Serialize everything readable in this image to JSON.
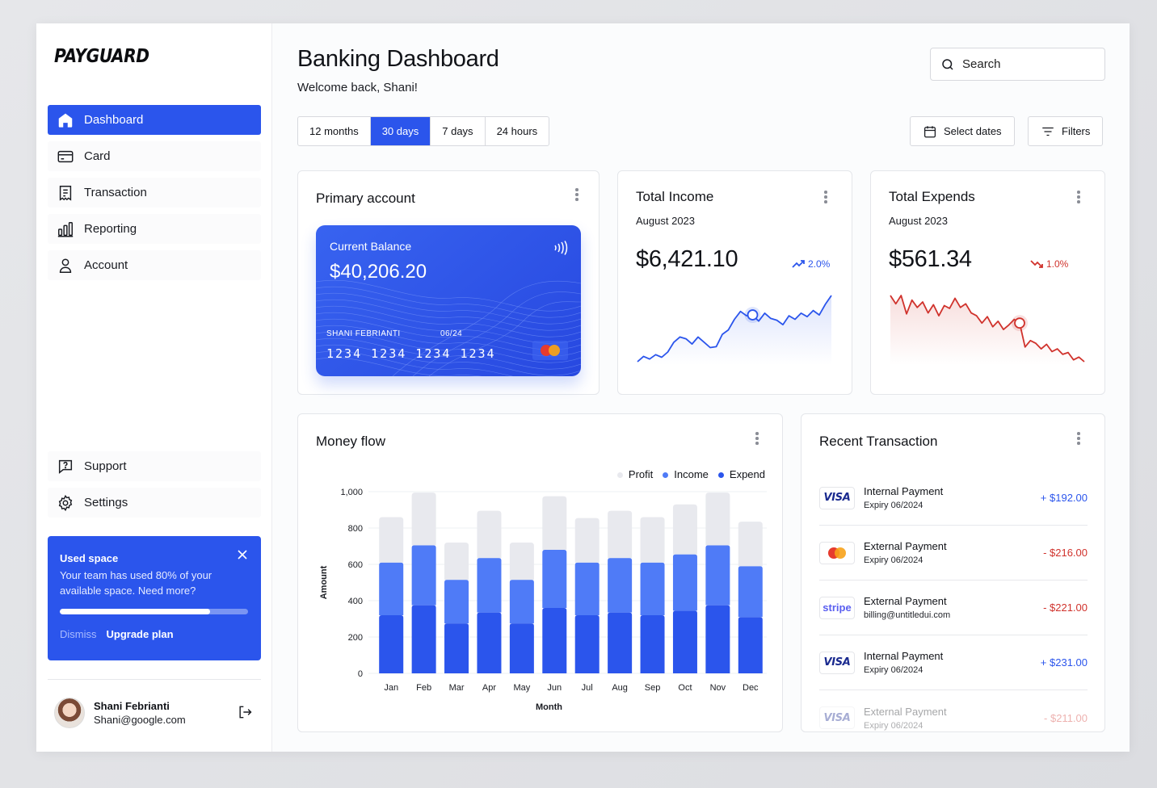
{
  "brand": "PAYGUARD",
  "nav": {
    "items": [
      {
        "label": "Dashboard",
        "icon": "home-icon"
      },
      {
        "label": "Card",
        "icon": "card-icon"
      },
      {
        "label": "Transaction",
        "icon": "receipt-icon"
      },
      {
        "label": "Reporting",
        "icon": "bar-chart-icon"
      },
      {
        "label": "Account",
        "icon": "user-icon"
      }
    ],
    "bottom": [
      {
        "label": "Support",
        "icon": "help-icon"
      },
      {
        "label": "Settings",
        "icon": "gear-icon"
      }
    ]
  },
  "promo": {
    "title": "Used space",
    "text": "Your team has used 80% of your available space. Need more?",
    "progress": 0.8,
    "dismiss": "Dismiss",
    "upgrade": "Upgrade plan"
  },
  "user": {
    "name": "Shani Febrianti",
    "email": "Shani@google.com"
  },
  "header": {
    "title": "Banking Dashboard",
    "subtitle": "Welcome back, Shani!",
    "search_placeholder": "Search"
  },
  "range_tabs": [
    "12 months",
    "30 days",
    "7 days",
    "24 hours"
  ],
  "active_range": 1,
  "buttons": {
    "select_dates": "Select dates",
    "filters": "Filters"
  },
  "primary_account": {
    "title": "Primary account",
    "card": {
      "label": "Current Balance",
      "balance": "$40,206.20",
      "holder": "SHANI FEBRIANTI",
      "expiry": "06/24",
      "number": "1234 1234 1234 1234"
    }
  },
  "income": {
    "title": "Total Income",
    "period": "August 2023",
    "amount": "$6,421.10",
    "change": "2.0%",
    "direction": "up",
    "color": "#2b55ec",
    "sparkline": [
      8,
      14,
      11,
      16,
      13,
      19,
      30,
      36,
      34,
      28,
      36,
      30,
      24,
      25,
      39,
      44,
      56,
      65,
      60,
      61,
      54,
      63,
      57,
      55,
      50,
      60,
      56,
      63,
      59,
      66,
      61,
      73,
      83
    ]
  },
  "expends": {
    "title": "Total Expends",
    "period": "August 2023",
    "amount": "$561.34",
    "change": "1.0%",
    "direction": "down",
    "color": "#d0322c",
    "sparkline": [
      82,
      73,
      82,
      62,
      77,
      69,
      75,
      63,
      72,
      60,
      71,
      68,
      79,
      69,
      73,
      63,
      60,
      52,
      59,
      48,
      54,
      45,
      50,
      56,
      52,
      26,
      33,
      30,
      24,
      29,
      21,
      24,
      18,
      20,
      12,
      15,
      10
    ]
  },
  "money_flow": {
    "title": "Money flow",
    "legend": [
      {
        "label": "Profit",
        "color": "#e8e9ee"
      },
      {
        "label": "Income",
        "color": "#4f7bf7"
      },
      {
        "label": "Expend",
        "color": "#2b55ec"
      }
    ]
  },
  "chart_data": {
    "type": "bar",
    "stacked": true,
    "title": "Money flow",
    "xlabel": "Month",
    "ylabel": "Amount",
    "ylim": [
      0,
      1000
    ],
    "yticks": [
      "0",
      "200",
      "400",
      "600",
      "800",
      "1,000"
    ],
    "categories": [
      "Jan",
      "Feb",
      "Mar",
      "Apr",
      "May",
      "Jun",
      "Jul",
      "Aug",
      "Sep",
      "Oct",
      "Nov",
      "Dec"
    ],
    "series": [
      {
        "name": "Expend",
        "values": [
          320,
          375,
          275,
          335,
          275,
          360,
          320,
          335,
          320,
          345,
          375,
          310
        ],
        "color": "#2b55ec"
      },
      {
        "name": "Income",
        "values": [
          290,
          330,
          240,
          300,
          240,
          320,
          290,
          300,
          290,
          310,
          330,
          280
        ],
        "color": "#4f7bf7"
      },
      {
        "name": "Profit",
        "values": [
          250,
          290,
          205,
          260,
          205,
          295,
          245,
          260,
          250,
          275,
          290,
          245
        ],
        "color": "#e8e9ee"
      }
    ],
    "grid": true,
    "legend_position": "top-right"
  },
  "recent": {
    "title": "Recent Transaction",
    "items": [
      {
        "logo": "visa",
        "logo_text": "VISA",
        "name": "Internal Payment",
        "sub": "Expiry 06/2024",
        "amount": "+ $192.00",
        "type": "pos"
      },
      {
        "logo": "mastercard",
        "logo_text": "",
        "name": "External Payment",
        "sub": "Expiry 06/2024",
        "amount": "- $216.00",
        "type": "neg"
      },
      {
        "logo": "stripe",
        "logo_text": "stripe",
        "name": "External Payment",
        "sub": "billing@untitledui.com",
        "amount": "- $221.00",
        "type": "neg"
      },
      {
        "logo": "visa",
        "logo_text": "VISA",
        "name": "Internal Payment",
        "sub": "Expiry 06/2024",
        "amount": "+ $231.00",
        "type": "pos"
      },
      {
        "logo": "visa",
        "logo_text": "VISA",
        "name": "External Payment",
        "sub": "Expiry 06/2024",
        "amount": "- $211.00",
        "type": "neg"
      }
    ]
  }
}
